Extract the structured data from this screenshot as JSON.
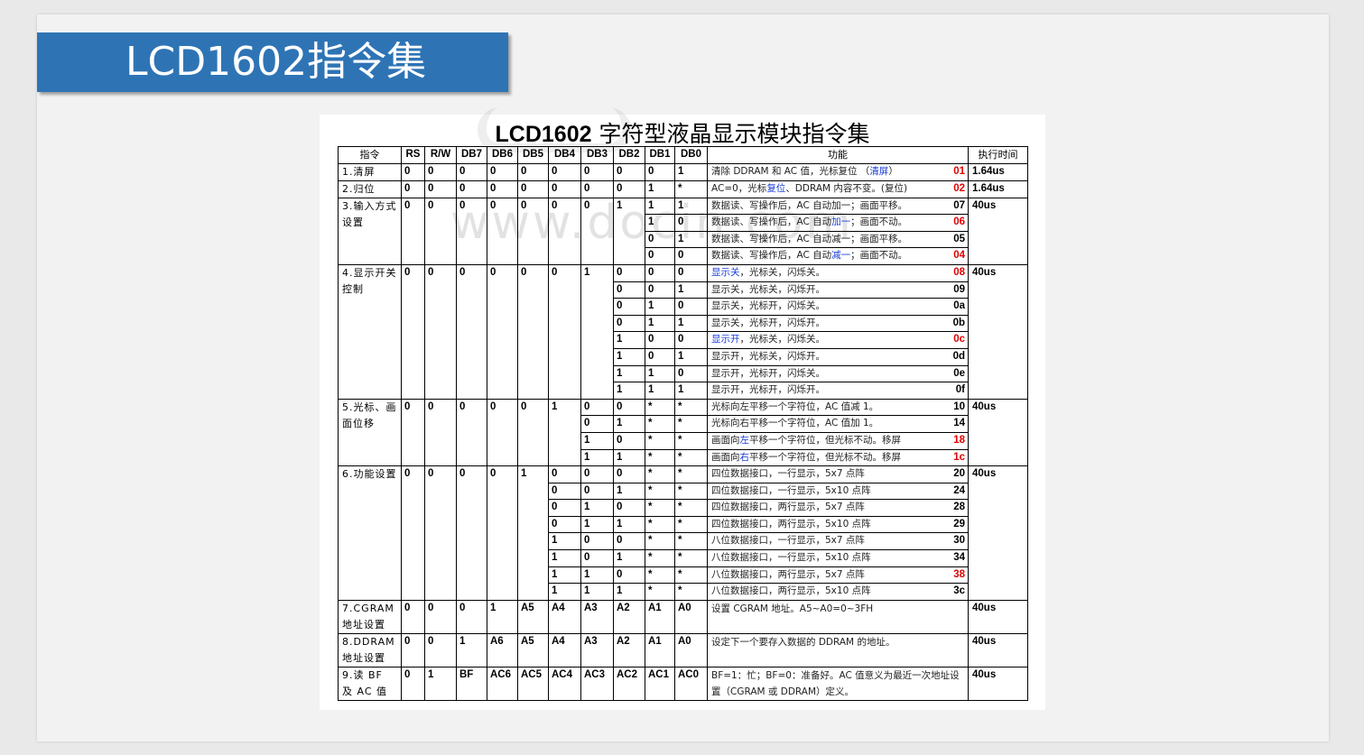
{
  "slide_title": "LCD1602指令集",
  "doc_title_bold": "LCD1602",
  "doc_title_rest": " 字符型液晶显示模块指令集",
  "watermark": "www.docin.com",
  "headers": [
    "指令",
    "RS",
    "R/W",
    "DB7",
    "DB6",
    "DB5",
    "DB4",
    "DB3",
    "DB2",
    "DB1",
    "DB0",
    "功能",
    "执行时间"
  ],
  "rows": {
    "r1": {
      "cmd": "1.清屏",
      "bits": [
        "0",
        "0",
        "0",
        "0",
        "0",
        "0",
        "0",
        "0",
        "0",
        "1"
      ],
      "func": "清除 DDRAM 和 AC 值，光标复位 （清屏）",
      "code": "01",
      "time": "1.64us"
    },
    "r2": {
      "cmd": "2.归位",
      "bits": [
        "0",
        "0",
        "0",
        "0",
        "0",
        "0",
        "0",
        "0",
        "1",
        "*"
      ],
      "func": "AC=0，光标复位、DDRAM 内容不变。(复位)",
      "code": "02",
      "time": "1.64us"
    },
    "r3": {
      "cmd": "3.输入方式设置",
      "bits": [
        "0",
        "0",
        "0",
        "0",
        "0",
        "0",
        "0",
        "1"
      ],
      "time": "40us",
      "subs": [
        {
          "bits": [
            "1",
            "1"
          ],
          "func": "数据读、写操作后，AC 自动加一；画面平移。",
          "code": "07"
        },
        {
          "bits": [
            "1",
            "0"
          ],
          "func": "数据读、写操作后，AC 自动加一；画面不动。",
          "code": "06"
        },
        {
          "bits": [
            "0",
            "1"
          ],
          "func": "数据读、写操作后，AC 自动减一；画面平移。",
          "code": "05"
        },
        {
          "bits": [
            "0",
            "0"
          ],
          "func": "数据读、写操作后，AC 自动减一；画面不动。",
          "code": "04"
        }
      ]
    },
    "r4": {
      "cmd": "4.显示开关控制",
      "bits": [
        "0",
        "0",
        "0",
        "0",
        "0",
        "0",
        "1"
      ],
      "time": "40us",
      "subs": [
        {
          "bits": [
            "0",
            "0",
            "0"
          ],
          "func": "显示关，光标关，闪烁关。",
          "code": "08"
        },
        {
          "bits": [
            "0",
            "0",
            "1"
          ],
          "func": "显示关，光标关，闪烁开。",
          "code": "09"
        },
        {
          "bits": [
            "0",
            "1",
            "0"
          ],
          "func": "显示关，光标开，闪烁关。",
          "code": "0a"
        },
        {
          "bits": [
            "0",
            "1",
            "1"
          ],
          "func": "显示关，光标开，闪烁开。",
          "code": "0b"
        },
        {
          "bits": [
            "1",
            "0",
            "0"
          ],
          "func": "显示开，光标关，闪烁关。",
          "code": "0c"
        },
        {
          "bits": [
            "1",
            "0",
            "1"
          ],
          "func": "显示开，光标关，闪烁开。",
          "code": "0d"
        },
        {
          "bits": [
            "1",
            "1",
            "0"
          ],
          "func": "显示开，光标开，闪烁关。",
          "code": "0e"
        },
        {
          "bits": [
            "1",
            "1",
            "1"
          ],
          "func": "显示开，光标开，闪烁开。",
          "code": "0f"
        }
      ]
    },
    "r5": {
      "cmd": "5.光标、画面位移",
      "bits": [
        "0",
        "0",
        "0",
        "0",
        "0",
        "1"
      ],
      "time": "40us",
      "subs": [
        {
          "bits": [
            "0",
            "0",
            "*",
            "*"
          ],
          "func": "光标向左平移一个字符位，AC 值减 1。",
          "code": "10"
        },
        {
          "bits": [
            "0",
            "1",
            "*",
            "*"
          ],
          "func": "光标向右平移一个字符位，AC 值加 1。",
          "code": "14"
        },
        {
          "bits": [
            "1",
            "0",
            "*",
            "*"
          ],
          "func": "画面向左平移一个字符位，但光标不动。移屏",
          "code": "18"
        },
        {
          "bits": [
            "1",
            "1",
            "*",
            "*"
          ],
          "func": "画面向右平移一个字符位，但光标不动。移屏",
          "code": "1c"
        }
      ]
    },
    "r6": {
      "cmd": "6.功能设置",
      "bits": [
        "0",
        "0",
        "0",
        "0",
        "1"
      ],
      "time": "40us",
      "subs": [
        {
          "bits": [
            "0",
            "0",
            "0",
            "*",
            "*"
          ],
          "func": "四位数据接口，一行显示，5x7 点阵",
          "code": "20"
        },
        {
          "bits": [
            "0",
            "0",
            "1",
            "*",
            "*"
          ],
          "func": "四位数据接口，一行显示，5x10 点阵",
          "code": "24"
        },
        {
          "bits": [
            "0",
            "1",
            "0",
            "*",
            "*"
          ],
          "func": "四位数据接口，两行显示，5x7 点阵",
          "code": "28"
        },
        {
          "bits": [
            "0",
            "1",
            "1",
            "*",
            "*"
          ],
          "func": "四位数据接口，两行显示，5x10 点阵",
          "code": "29"
        },
        {
          "bits": [
            "1",
            "0",
            "0",
            "*",
            "*"
          ],
          "func": "八位数据接口，一行显示，5x7 点阵",
          "code": "30"
        },
        {
          "bits": [
            "1",
            "0",
            "1",
            "*",
            "*"
          ],
          "func": "八位数据接口，一行显示，5x10 点阵",
          "code": "34"
        },
        {
          "bits": [
            "1",
            "1",
            "0",
            "*",
            "*"
          ],
          "func": "八位数据接口，两行显示，5x7 点阵",
          "code": "38"
        },
        {
          "bits": [
            "1",
            "1",
            "1",
            "*",
            "*"
          ],
          "func": "八位数据接口，两行显示，5x10 点阵",
          "code": "3c"
        }
      ]
    },
    "r7": {
      "cmd": "7.CGRAM 地址设置",
      "bits": [
        "0",
        "0",
        "0",
        "1",
        "A5",
        "A4",
        "A3",
        "A2",
        "A1",
        "A0"
      ],
      "func": "设置 CGRAM 地址。A5~A0=0~3FH",
      "time": "40us"
    },
    "r8": {
      "cmd": "8.DDRAM 地址设置",
      "bits": [
        "0",
        "0",
        "1",
        "A6",
        "A5",
        "A4",
        "A3",
        "A2",
        "A1",
        "A0"
      ],
      "func": "设定下一个要存入数据的 DDRAM 的地址。",
      "time": "40us"
    },
    "r9": {
      "cmd": "9.读 BF 及 AC 值",
      "bits": [
        "0",
        "1",
        "BF",
        "AC6",
        "AC5",
        "AC4",
        "AC3",
        "AC2",
        "AC1",
        "AC0"
      ],
      "func": "BF=1：忙；BF=0：准备好。AC 值意义为最近一次地址设置（CGRAM 或 DDRAM）定义。",
      "time": "40us"
    }
  },
  "colors": {
    "title_bar": "#2e74b5",
    "code_red": "#e00000",
    "highlight_blue": "#1a3ed8"
  }
}
